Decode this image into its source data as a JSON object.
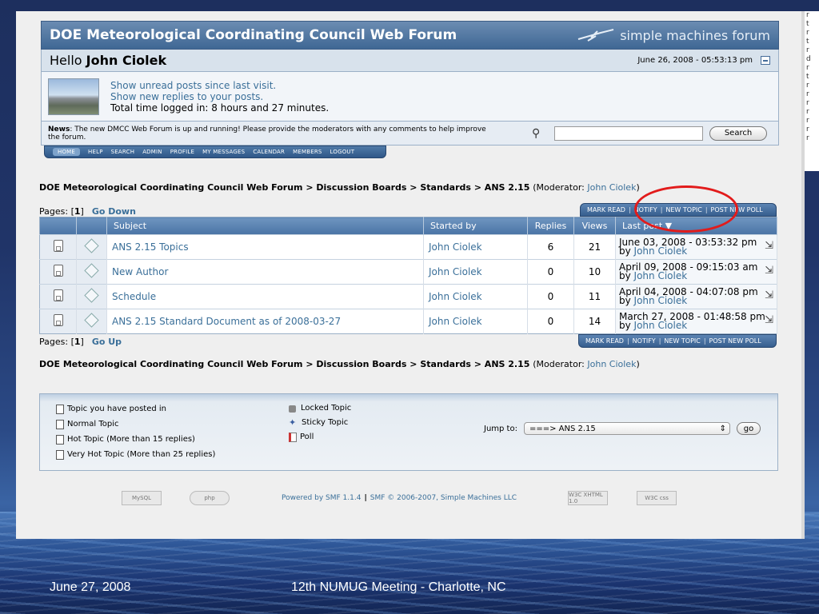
{
  "forum": {
    "title": "DOE Meteorological Coordinating Council Web Forum",
    "logo_text": "simple machines forum",
    "hello_prefix": "Hello",
    "user_name": "John Ciolek",
    "datetime": "June 26, 2008 - 05:53:13 pm",
    "user_links": [
      "Show unread posts since last visit.",
      "Show new replies to your posts."
    ],
    "time_logged": "Total time logged in: 8 hours and 27 minutes.",
    "news_label": "News",
    "news_text": ": The new DMCC Web Forum is up and running!  Please provide the moderators with any comments to help improve the forum.",
    "search_button": "Search",
    "menu": [
      "HOME",
      "HELP",
      "SEARCH",
      "ADMIN",
      "PROFILE",
      "MY MESSAGES",
      "CALENDAR",
      "MEMBERS",
      "LOGOUT"
    ]
  },
  "breadcrumb": {
    "text": "DOE Meteorological Coordinating Council Web Forum > Discussion Boards > Standards > ANS 2.15",
    "moderator_prefix": "(Moderator: ",
    "moderator": "John Ciolek",
    "moderator_suffix": ")"
  },
  "pages": {
    "label": "Pages: [",
    "current": "1",
    "suffix": "]",
    "go_down": "Go Down",
    "go_up": "Go Up"
  },
  "actions": [
    "MARK READ",
    "NOTIFY",
    "NEW TOPIC",
    "POST NEW POLL"
  ],
  "table": {
    "headers": {
      "subject": "Subject",
      "started_by": "Started by",
      "replies": "Replies",
      "views": "Views",
      "last_post": "Last post"
    },
    "rows": [
      {
        "subject": "ANS 2.15 Topics",
        "started_by": "John Ciolek",
        "replies": "6",
        "views": "21",
        "last_date": "June 03, 2008 - 03:53:32 pm",
        "by": "by",
        "last_by": "John Ciolek"
      },
      {
        "subject": "New Author",
        "started_by": "John Ciolek",
        "replies": "0",
        "views": "10",
        "last_date": "April 09, 2008 - 09:15:03 am",
        "by": "by",
        "last_by": "John Ciolek"
      },
      {
        "subject": "Schedule",
        "started_by": "John Ciolek",
        "replies": "0",
        "views": "11",
        "last_date": "April 04, 2008 - 04:07:08 pm",
        "by": "by",
        "last_by": "John Ciolek"
      },
      {
        "subject": "ANS 2.15 Standard Document as of 2008-03-27",
        "started_by": "John Ciolek",
        "replies": "0",
        "views": "14",
        "last_date": "March 27, 2008 - 01:48:58 pm",
        "by": "by",
        "last_by": "John Ciolek"
      }
    ]
  },
  "legend": {
    "left": [
      "Topic you have posted in",
      "Normal Topic",
      "Hot Topic (More than 15 replies)",
      "Very Hot Topic (More than 25 replies)"
    ],
    "right": [
      "Locked Topic",
      "Sticky Topic",
      "Poll"
    ],
    "jump_label": "Jump to:",
    "jump_value": "===> ANS 2.15",
    "go_button": "go"
  },
  "footer": {
    "powered": "Powered by SMF 1.1.4",
    "copyright": "SMF © 2006-2007, Simple Machines LLC",
    "badges": [
      "MySQL",
      "php",
      "W3C XHTML 1.0",
      "W3C css"
    ]
  },
  "slide": {
    "date": "June 27, 2008",
    "meeting": "12th NUMUG Meeting - Charlotte, NC"
  },
  "right_strip_letters": [
    "r",
    "t",
    "r",
    "t",
    "r",
    "d",
    "r",
    "t",
    "r",
    "r",
    "r",
    "r",
    "r",
    "r",
    "r"
  ],
  "colors": {
    "annotation": "#e21b1b",
    "link": "#3a6f99",
    "header": "#4a74a5"
  }
}
